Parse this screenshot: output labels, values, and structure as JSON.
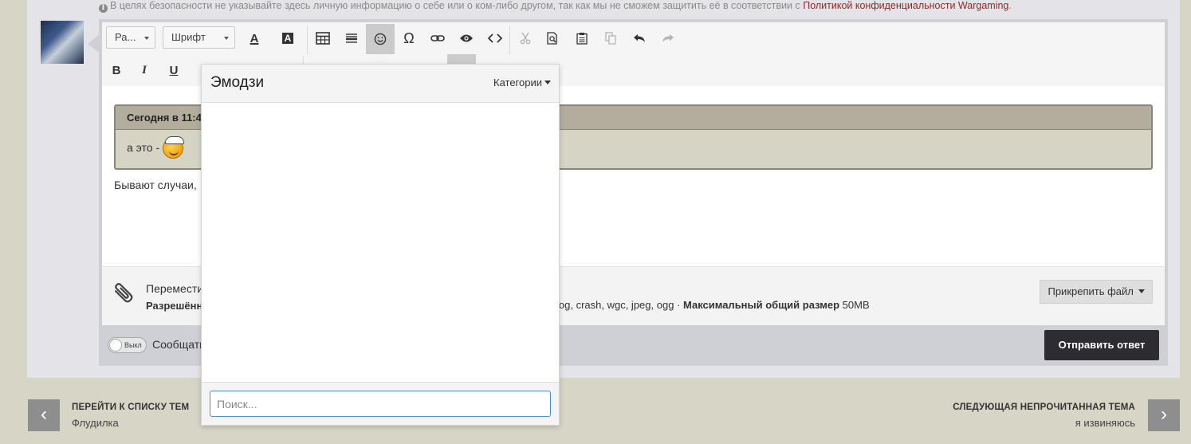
{
  "privacy": {
    "text": "В целях безопасности не указывайте здесь личную информацию о себе или о ком-либо другом, так как мы не сможем защитить её в соответствии с ",
    "link": "Политикой конфиденциальности Wargaming",
    "tail": "."
  },
  "toolbar": {
    "paragraph_select": "Ра...",
    "font_select": "Шрифт",
    "icons": {
      "text_color": "A",
      "bg_color": "A",
      "omega": "Ω",
      "bold": "B",
      "italic": "I",
      "underline": "U"
    }
  },
  "quote": {
    "header": "Сегодня в 11:4",
    "body": "а это - "
  },
  "body_text": "Бывают случаи,",
  "attach": {
    "line1": "Перемести",
    "line2_bold": "Разрешённ",
    "tail_text": "log, crash, wgc, jpeg, ogg · ",
    "tail_bold": "Максимальный общий размер",
    "tail_size": " 50MB",
    "button": "Прикрепить файл"
  },
  "footer": {
    "toggle_label": "Выкл",
    "notify_text": "Сообщать",
    "send_button": "Отправить ответ"
  },
  "nav": {
    "left_title": "ПЕРЕЙТИ К СПИСКУ ТЕМ",
    "left_sub": "Флудилка",
    "right_title": "СЛЕДУЮЩАЯ НЕПРОЧИТАННАЯ ТЕМА",
    "right_sub": "я извиняюсь"
  },
  "emoji_popup": {
    "title": "Эмодзи",
    "categories": "Категории",
    "search_placeholder": "Поиск..."
  }
}
